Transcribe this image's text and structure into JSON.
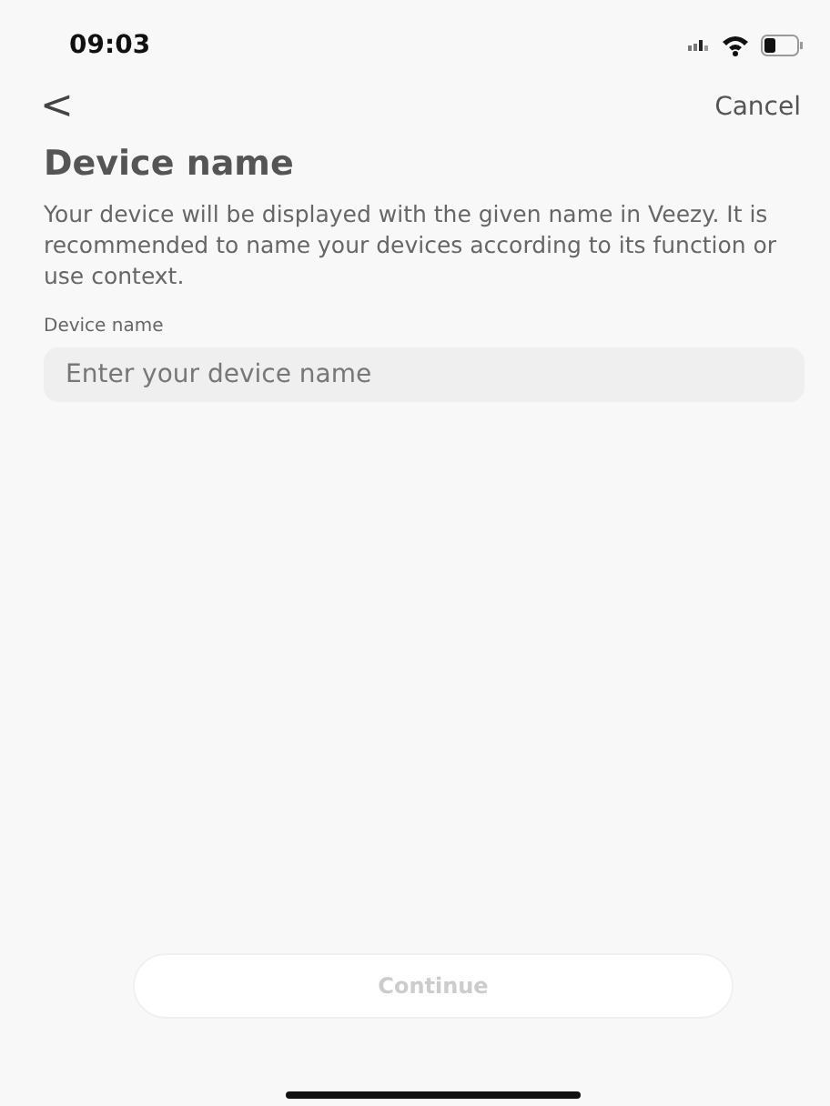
{
  "status_bar": {
    "time": "09:03"
  },
  "nav": {
    "back": "<",
    "cancel": "Cancel"
  },
  "title": "Device name",
  "description": "Your device will be displayed with the given name in Veezy. It is recommended to name your devices according to its function or use context.",
  "field": {
    "label": "Device name",
    "placeholder": "Enter your device name"
  },
  "continue_button": {
    "label": "Continue",
    "disabled": true
  }
}
